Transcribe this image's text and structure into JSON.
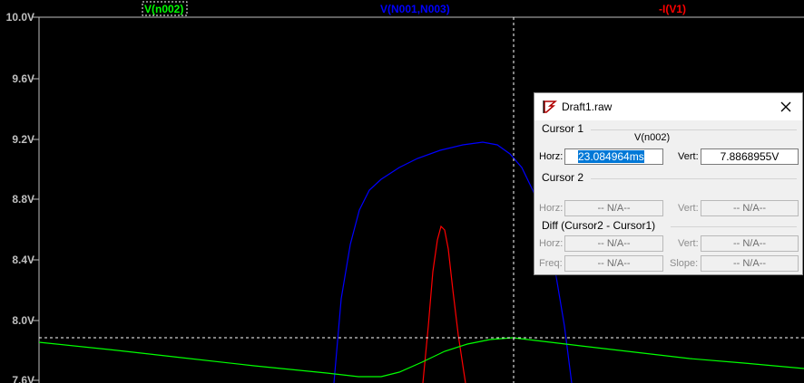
{
  "plot": {
    "traces": [
      {
        "label": "V(n002)",
        "color": "#00ff00"
      },
      {
        "label": "V(N001,N003)",
        "color": "#0000ff"
      },
      {
        "label": "-I(V1)",
        "color": "#ff0000"
      }
    ],
    "y_ticks": [
      "10.0V",
      "9.6V",
      "9.2V",
      "8.8V",
      "8.4V",
      "8.0V",
      "7.6V"
    ],
    "axis_color": "#c0c0c0"
  },
  "dialog": {
    "title": "Draft1.raw",
    "cursor1": {
      "group_label": "Cursor 1",
      "trace_name": "V(n002)",
      "horz_label": "Horz:",
      "horz_value": "23.084964ms",
      "vert_label": "Vert:",
      "vert_value": "7.8868955V"
    },
    "cursor2": {
      "group_label": "Cursor 2",
      "horz_label": "Horz:",
      "horz_value": "-- N/A--",
      "vert_label": "Vert:",
      "vert_value": "-- N/A--"
    },
    "diff": {
      "group_label": "Diff (Cursor2 - Cursor1)",
      "horz_label": "Horz:",
      "horz_value": "-- N/A--",
      "vert_label": "Vert:",
      "vert_value": "-- N/A--",
      "freq_label": "Freq:",
      "freq_value": "-- N/A--",
      "slope_label": "Slope:",
      "slope_value": "-- N/A--"
    }
  }
}
